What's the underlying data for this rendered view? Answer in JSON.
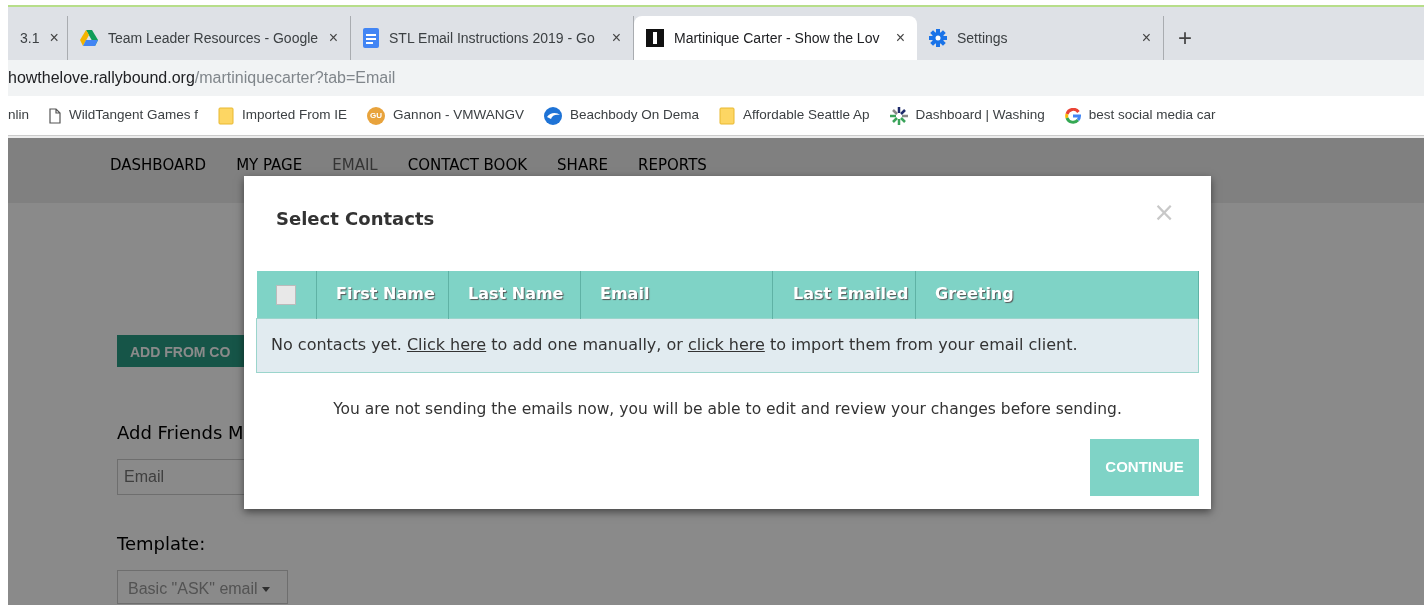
{
  "browser": {
    "tabs": [
      {
        "title": "3.1",
        "kind": "plain",
        "close": "×",
        "selected": false
      },
      {
        "title": "Team Leader Resources - Google",
        "kind": "drive",
        "close": "×",
        "selected": false
      },
      {
        "title": "STL Email Instructions 2019 - Go",
        "kind": "doc",
        "close": "×",
        "selected": false
      },
      {
        "title": "Martinique Carter - Show the Lov",
        "kind": "square",
        "close": "×",
        "selected": true
      },
      {
        "title": "Settings",
        "kind": "gear",
        "close": "×",
        "selected": false
      }
    ],
    "new_tab": "+",
    "address": {
      "host": "howthelove.rallybound.org",
      "path": "/martiniquecarter?tab=Email"
    },
    "bookmarks": [
      {
        "label": "nlin",
        "kind": "plain"
      },
      {
        "label": "WildTangent Games f",
        "kind": "page"
      },
      {
        "label": "Imported From IE",
        "kind": "folder"
      },
      {
        "label": "Gannon - VMWANGV",
        "kind": "badge",
        "badge_text": "GU"
      },
      {
        "label": "Beachbody On Dema",
        "kind": "globe"
      },
      {
        "label": "Affordable Seattle Ap",
        "kind": "folder"
      },
      {
        "label": "Dashboard | Washing",
        "kind": "burst"
      },
      {
        "label": "best social media car",
        "kind": "g"
      }
    ]
  },
  "nav": [
    {
      "label": "DASHBOARD",
      "selected": false
    },
    {
      "label": "MY PAGE",
      "selected": false
    },
    {
      "label": "EMAIL",
      "selected": true
    },
    {
      "label": "CONTACT BOOK",
      "selected": false
    },
    {
      "label": "SHARE",
      "selected": false
    },
    {
      "label": "REPORTS",
      "selected": false
    }
  ],
  "page": {
    "add_button": "ADD FROM CO",
    "add_heading": "Add Friends M",
    "email_placeholder": "Email",
    "template_label": "Template:",
    "template_value": "Basic \"ASK\" email"
  },
  "modal": {
    "title": "Select Contacts",
    "close": "×",
    "table": {
      "select_all": {
        "checked": false
      },
      "columns": [
        "First Name",
        "Last Name",
        "Email",
        "Last Emailed",
        "Greeting"
      ],
      "empty_message": [
        {
          "kind": "text",
          "text": "No contacts yet. "
        },
        {
          "kind": "link",
          "text": "Click here"
        },
        {
          "kind": "text",
          "text": " to add one manually, or "
        },
        {
          "kind": "link",
          "text": "click here"
        },
        {
          "kind": "text",
          "text": " to import them from your email client."
        }
      ]
    },
    "note": "You are not sending the emails now, you will be able to edit and review your changes before sending.",
    "continue": "CONTINUE"
  }
}
